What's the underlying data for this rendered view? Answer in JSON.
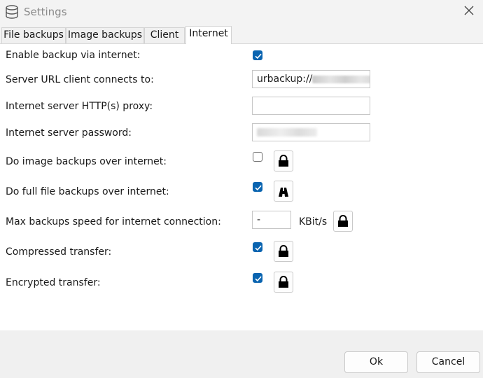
{
  "window": {
    "title": "Settings"
  },
  "tabs": [
    {
      "label": "File backups",
      "active": false
    },
    {
      "label": "Image backups",
      "active": false
    },
    {
      "label": "Client",
      "active": false
    },
    {
      "label": "Internet",
      "active": true
    }
  ],
  "internet": {
    "enable_backup": {
      "label": "Enable backup via internet:",
      "checked": true
    },
    "server_url": {
      "label": "Server URL client connects to:",
      "value": "urbackup://"
    },
    "proxy": {
      "label": "Internet server HTTP(s) proxy:",
      "value": ""
    },
    "password": {
      "label": "Internet server password:",
      "value": ""
    },
    "image_backups": {
      "label": "Do image backups over internet:",
      "checked": false,
      "lock_icon": "lock-icon"
    },
    "full_file_backups": {
      "label": "Do full file backups over internet:",
      "checked": true,
      "lock_icon": "lock-open-icon"
    },
    "max_speed": {
      "label": "Max backups speed for internet connection:",
      "value": "-",
      "unit": "KBit/s",
      "lock_icon": "lock-icon"
    },
    "compressed": {
      "label": "Compressed transfer:",
      "checked": true,
      "lock_icon": "lock-icon"
    },
    "encrypted": {
      "label": "Encrypted transfer:",
      "checked": true,
      "lock_icon": "lock-icon"
    }
  },
  "buttons": {
    "ok": "Ok",
    "cancel": "Cancel"
  },
  "colors": {
    "accent": "#0a64b0",
    "panel_bg": "#ffffff",
    "window_bg": "#f3f3f3"
  }
}
